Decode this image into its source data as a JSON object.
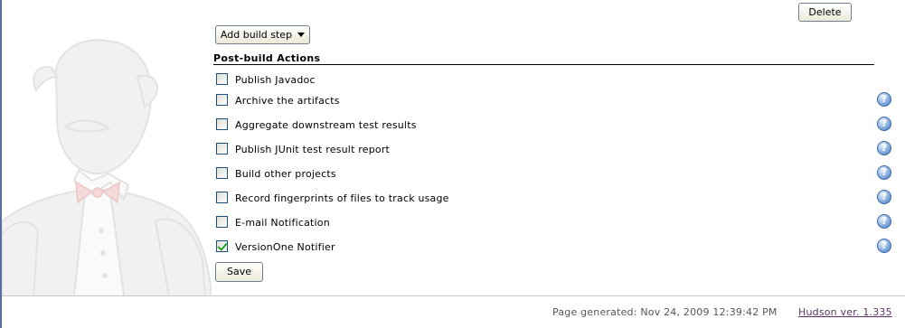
{
  "buttons": {
    "delete": "Delete",
    "add_build_step": "Add build step",
    "save": "Save"
  },
  "post_build": {
    "title": "Post-build Actions",
    "actions": [
      {
        "label": "Publish Javadoc",
        "checked": false,
        "help": false
      },
      {
        "label": "Archive the artifacts",
        "checked": false,
        "help": true
      },
      {
        "label": "Aggregate downstream test results",
        "checked": false,
        "help": true
      },
      {
        "label": "Publish JUnit test result report",
        "checked": false,
        "help": true
      },
      {
        "label": "Build other projects",
        "checked": false,
        "help": true
      },
      {
        "label": "Record fingerprints of files to track usage",
        "checked": false,
        "help": true
      },
      {
        "label": "E-mail Notification",
        "checked": false,
        "help": true
      },
      {
        "label": "VersionOne Notifier",
        "checked": true,
        "help": true
      }
    ],
    "help_glyph": "?"
  },
  "footer": {
    "generated": "Page generated: Nov 24, 2009 12:39:42 PM",
    "version_link": "Hudson ver. 1.335"
  },
  "icons": {
    "mascot": "butler-mascot-icon",
    "help": "help-icon",
    "dropdown": "caret-down-icon"
  },
  "colors": {
    "border": "#5a6f9a",
    "check": "#21a121",
    "help": "#3e6aa8",
    "link": "#5c3566"
  }
}
